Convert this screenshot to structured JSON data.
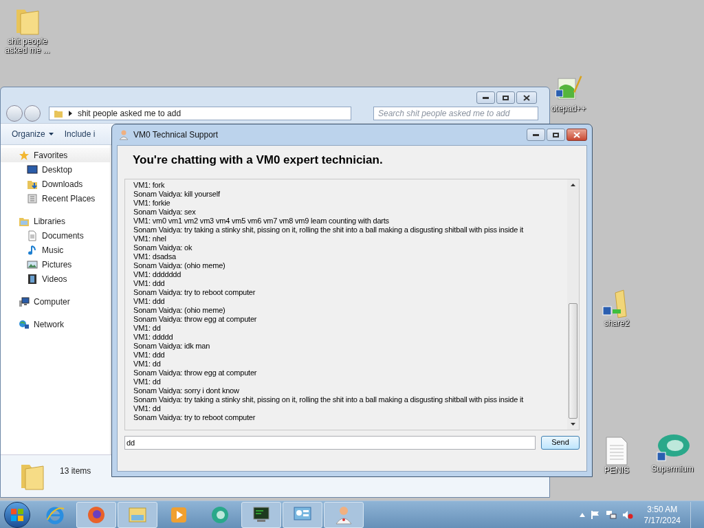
{
  "desktop_icons": [
    {
      "kind": "folder",
      "label": "shit people asked me ..."
    },
    {
      "kind": "notepad",
      "label": "otepad++"
    },
    {
      "kind": "share",
      "label": "share2"
    },
    {
      "kind": "file",
      "label": "PENIS"
    },
    {
      "kind": "supermium",
      "label": "Supermium"
    }
  ],
  "explorer": {
    "address": "shit people asked me to add",
    "search_placeholder": "Search shit people asked me to add",
    "toolbar": [
      "Organize",
      "Include i"
    ],
    "sidebar": [
      {
        "kind": "favorites",
        "label": "Favorites",
        "selected": true,
        "children": [
          {
            "kind": "desktop",
            "label": "Desktop",
            "selected": false
          },
          {
            "kind": "downloads",
            "label": "Downloads",
            "selected": false
          },
          {
            "kind": "recent",
            "label": "Recent Places",
            "selected": false
          }
        ]
      },
      {
        "kind": "libraries",
        "label": "Libraries",
        "selected": false,
        "children": [
          {
            "kind": "documents",
            "label": "Documents",
            "selected": false
          },
          {
            "kind": "music",
            "label": "Music",
            "selected": false
          },
          {
            "kind": "pictures",
            "label": "Pictures",
            "selected": false
          },
          {
            "kind": "videos",
            "label": "Videos",
            "selected": false
          }
        ]
      },
      {
        "kind": "computer",
        "label": "Computer",
        "selected": false
      },
      {
        "kind": "network",
        "label": "Network",
        "selected": false
      }
    ],
    "status": "13 items"
  },
  "chat": {
    "title": "VM0 Technical Support",
    "heading": "You're chatting with a VM0 expert technician.",
    "messages": [
      "VM1: fork",
      "Sonam Vaidya: kill yourself",
      "VM1: forkie",
      "Sonam Vaidya: sex",
      "VM1: vm0 vm1 vm2 vm3 vm4 vm5 vm6 vm7 vm8 vm9 leam counting with darts",
      "Sonam Vaidya: try taking a stinky shit, pissing on it, rolling the shit into a ball making a disgusting shitball with piss inside it",
      "VM1: nhel",
      "Sonam Vaidya: ok",
      "VM1: dsadsa",
      "Sonam Vaidya: (ohio meme)",
      "VM1: ddddddd",
      "VM1: ddd",
      "Sonam Vaidya: try to reboot computer",
      "VM1: ddd",
      "Sonam Vaidya: (ohio meme)",
      "Sonam Vaidya: throw egg at computer",
      "VM1: dd",
      "VM1: ddddd",
      "Sonam Vaidya: idk man",
      "VM1: ddd",
      "VM1: dd",
      "Sonam Vaidya: throw egg at computer",
      "VM1: dd",
      "Sonam Vaidya: sorry i dont know",
      "Sonam Vaidya: try taking a stinky shit, pissing on it, rolling the shit into a ball making a disgusting shitball with piss inside it",
      "VM1: dd",
      "Sonam Vaidya: try to reboot computer"
    ],
    "input": "dd",
    "send": "Send"
  },
  "taskbar": [
    {
      "kind": "ie",
      "running": false
    },
    {
      "kind": "firefox",
      "running": true
    },
    {
      "kind": "explorer",
      "running": true
    },
    {
      "kind": "media",
      "running": false
    },
    {
      "kind": "supermium",
      "running": false
    },
    {
      "kind": "terminal",
      "running": true
    },
    {
      "kind": "control",
      "running": true
    },
    {
      "kind": "support",
      "running": true
    }
  ],
  "clock": {
    "time": "3:50 AM",
    "date": "7/17/2024"
  }
}
